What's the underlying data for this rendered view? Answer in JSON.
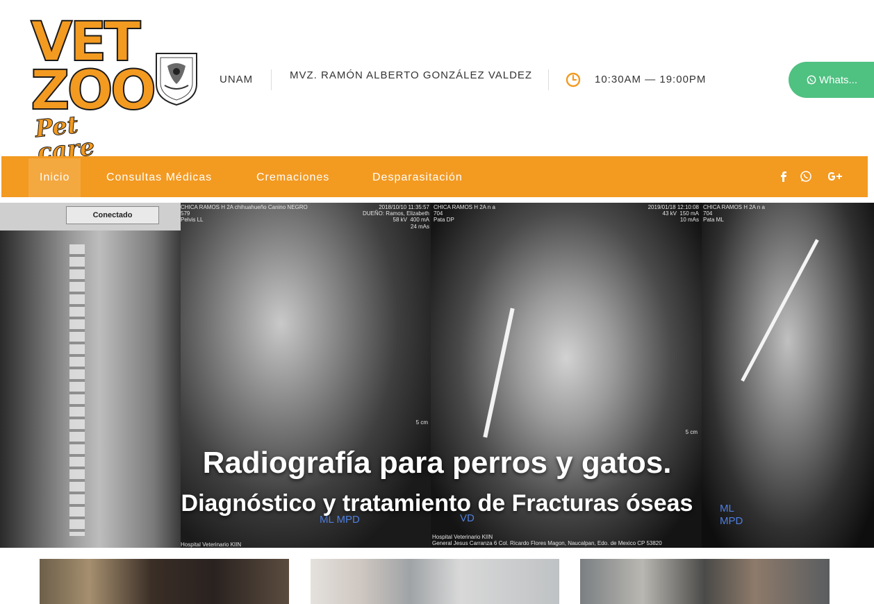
{
  "header": {
    "logo_text": {
      "line1": "VET",
      "line2": "ZOO",
      "line3": "Pet care"
    },
    "unam_label": "UNAM",
    "doctor_name": "MVZ. RAMÓN ALBERTO GONZÁLEZ VALDEZ",
    "hours": "10:30AM — 19:00PM",
    "whatsapp_label": "Whats..."
  },
  "nav": {
    "items": [
      {
        "label": "Inicio"
      },
      {
        "label": "Consultas Médicas"
      },
      {
        "label": "Cremaciones"
      },
      {
        "label": "Desparasitación"
      }
    ],
    "social": [
      "facebook-icon",
      "whatsapp-icon",
      "google-plus-icon"
    ]
  },
  "hero": {
    "title": "Radiografía para perros y gatos.",
    "subtitle": "Diagnóstico y tratamiento de Fracturas óseas",
    "xray": {
      "p1_status": "Conectado",
      "p2_header_left": "CHICA RAMOS H 2A chihuahueño Canino NEGRO\n579\nPelvis LL",
      "p2_header_right": "2018/10/10 11:35:57\nDUEÑO: Ramos, Elizabeth\n58 kV  400 mA\n24 mAs",
      "p2_footer": "Hospital Veterinario KIIN",
      "p3_header_left": "CHICA RAMOS H 2A n a\n704\nPata DP",
      "p3_header_right": "2019/01/18 12:10:08\n43 kV  150 mA\n10 mAs",
      "p3_label": "VD",
      "p3_footer": "Hospital Veterinario KIIN\nGeneral Jesus Carranza 6 Col. Ricardo Flores Magon, Naucalpan, Edo. de Mexico CP 53820",
      "p4_header": "CHICA RAMOS H 2A n a\n704\nPata ML",
      "p4_label": "ML\nMPD",
      "p2_label": "ML MPD",
      "scale": "5 cm"
    },
    "colors": {
      "accent": "#f39a21",
      "whatsapp": "#4fc181"
    }
  }
}
